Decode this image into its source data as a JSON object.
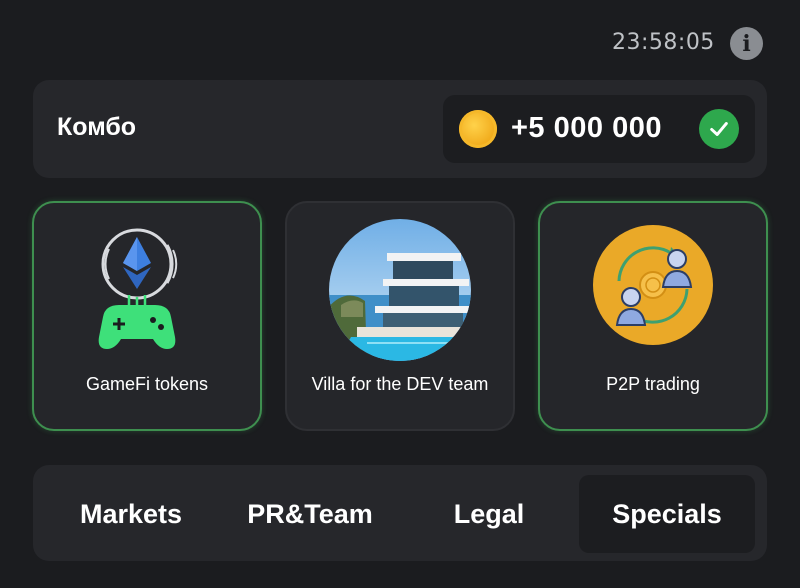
{
  "header": {
    "timer": "23:58:05",
    "info_icon": "info-icon"
  },
  "combo": {
    "title": "Комбо",
    "reward": "+5 000 000",
    "coin_icon": "coin-icon",
    "status_icon": "checkmark-icon",
    "status_color": "#2ea84d"
  },
  "cards": [
    {
      "label": "GameFi tokens",
      "icon": "gamepad-ethereum-icon",
      "completed": true
    },
    {
      "label": "Villa for the DEV team",
      "icon": "villa-image",
      "completed": false
    },
    {
      "label": "P2P trading",
      "icon": "p2p-exchange-icon",
      "completed": true
    }
  ],
  "tabs": [
    {
      "label": "Markets",
      "active": false
    },
    {
      "label": "PR&Team",
      "active": false
    },
    {
      "label": "Legal",
      "active": false
    },
    {
      "label": "Specials",
      "active": true
    }
  ],
  "colors": {
    "background": "#1b1c1f",
    "panel": "#26272b",
    "accent_green": "#3e8f4f",
    "coin_gold": "#f0a91a"
  }
}
